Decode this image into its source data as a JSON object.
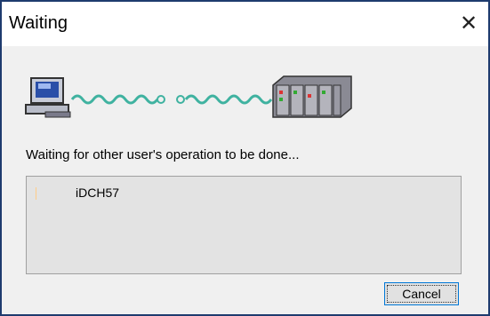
{
  "window": {
    "title": "Waiting",
    "close_glyph": "✕"
  },
  "status": {
    "message": "Waiting for other user's operation to be done..."
  },
  "list": {
    "items": [
      "iDCH57"
    ]
  },
  "buttons": {
    "cancel": "Cancel"
  },
  "icons": [
    "computer-icon",
    "wave-arrow-right-icon",
    "wave-arrow-left-icon",
    "plc-rack-icon"
  ],
  "colors": {
    "wave": "#3fb2a0",
    "border": "#1e3b6e",
    "button_focus": "#0078d7"
  }
}
